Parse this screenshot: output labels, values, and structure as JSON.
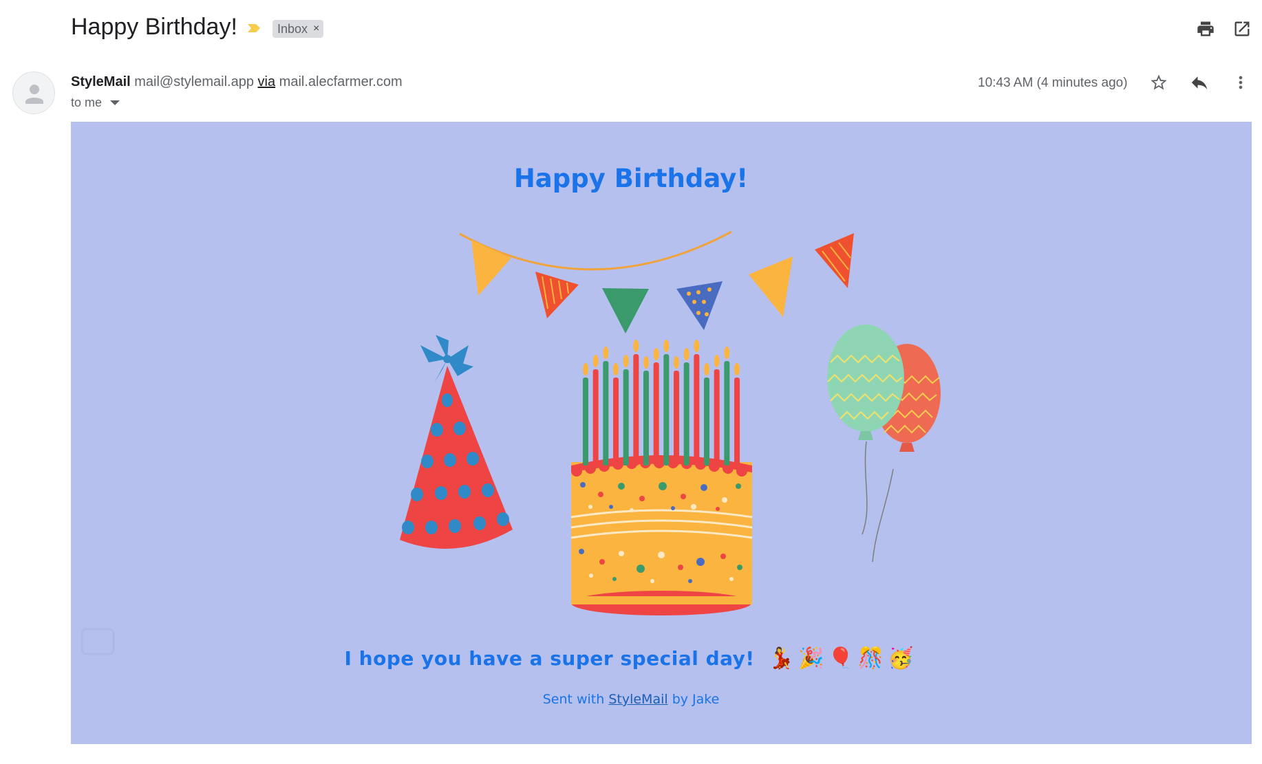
{
  "header": {
    "subject": "Happy Birthday!",
    "label": "Inbox",
    "label_remove": "×",
    "icons": [
      "importance-marker-icon",
      "print-icon",
      "open-new-window-icon"
    ]
  },
  "message": {
    "sender_name": "StyleMail",
    "sender_email": "mail@stylemail.app",
    "via_label": "via",
    "via_domain": "mail.alecfarmer.com",
    "to_label": "to me",
    "time": "10:43 AM (4 minutes ago)",
    "action_icons": [
      "star-icon",
      "reply-icon",
      "more-vert-icon"
    ]
  },
  "email_body": {
    "title": "Happy Birthday!",
    "message": "I hope you have a super special day!",
    "emojis": "💃🎉🎈🎊🥳",
    "sent_prefix": "Sent with",
    "sent_link": "StyleMail",
    "sent_suffix": "by Jake",
    "background": "#b5c0ef",
    "text_color": "#1a73e8"
  }
}
